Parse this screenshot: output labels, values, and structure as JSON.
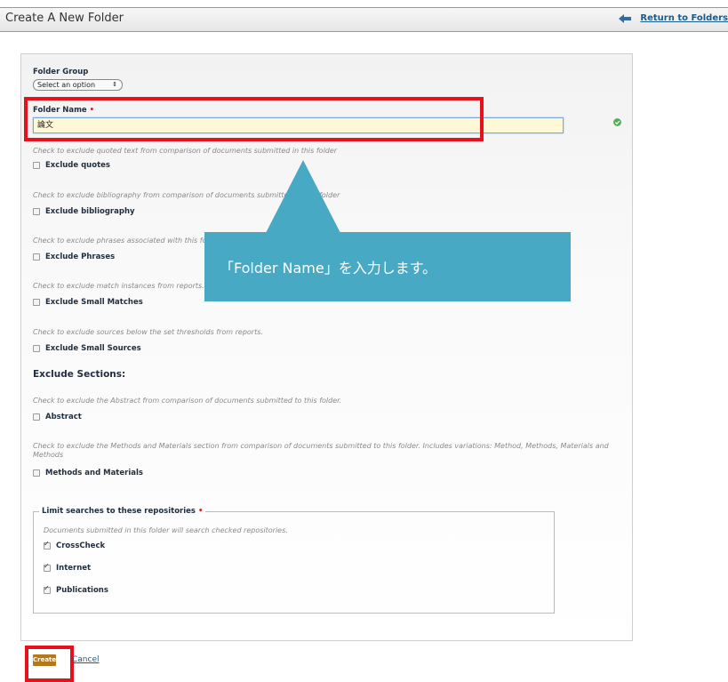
{
  "header": {
    "title": "Create A New Folder",
    "return_link": "Return to Folders"
  },
  "form": {
    "folder_group_label": "Folder Group",
    "folder_group_value": "Select an option",
    "folder_name_label": "Folder Name",
    "folder_name_value": "論文",
    "required_mark": "•",
    "options": [
      {
        "hint": "Check to exclude quoted text from comparison of documents submitted in this folder",
        "label": "Exclude quotes",
        "checked": false
      },
      {
        "hint": "Check to exclude bibliography from comparison of documents submitted in this folder",
        "label": "Exclude bibliography",
        "checked": false
      },
      {
        "hint": "Check to exclude phrases associated with this folder",
        "label": "Exclude Phrases",
        "checked": false
      },
      {
        "hint": "Check to exclude match instances from reports.",
        "label": "Exclude Small Matches",
        "checked": false
      },
      {
        "hint": "Check to exclude sources below the set thresholds from reports.",
        "label": "Exclude Small Sources",
        "checked": false
      }
    ],
    "exclude_sections_heading": "Exclude Sections:",
    "sections": [
      {
        "hint": "Check to exclude the Abstract from comparison of documents submitted to this folder.",
        "label": "Abstract",
        "checked": false
      },
      {
        "hint": "Check to exclude the Methods and Materials section from comparison of documents submitted to this folder. Includes variations: Method, Methods, Materials and Methods",
        "label": "Methods and Materials",
        "checked": false
      }
    ],
    "repositories": {
      "legend": "Limit searches to these repositories",
      "hint": "Documents submitted in this folder will search checked repositories.",
      "items": [
        {
          "label": "CrossCheck",
          "checked": true
        },
        {
          "label": "Internet",
          "checked": true
        },
        {
          "label": "Publications",
          "checked": true
        }
      ]
    }
  },
  "callout": {
    "text": "「Folder Name」を入力します。"
  },
  "actions": {
    "create_label": "Create",
    "cancel_label": "Cancel"
  },
  "colors": {
    "callout": "#48a9c5",
    "highlight": "#e8101a",
    "create_button": "#b4781f"
  }
}
